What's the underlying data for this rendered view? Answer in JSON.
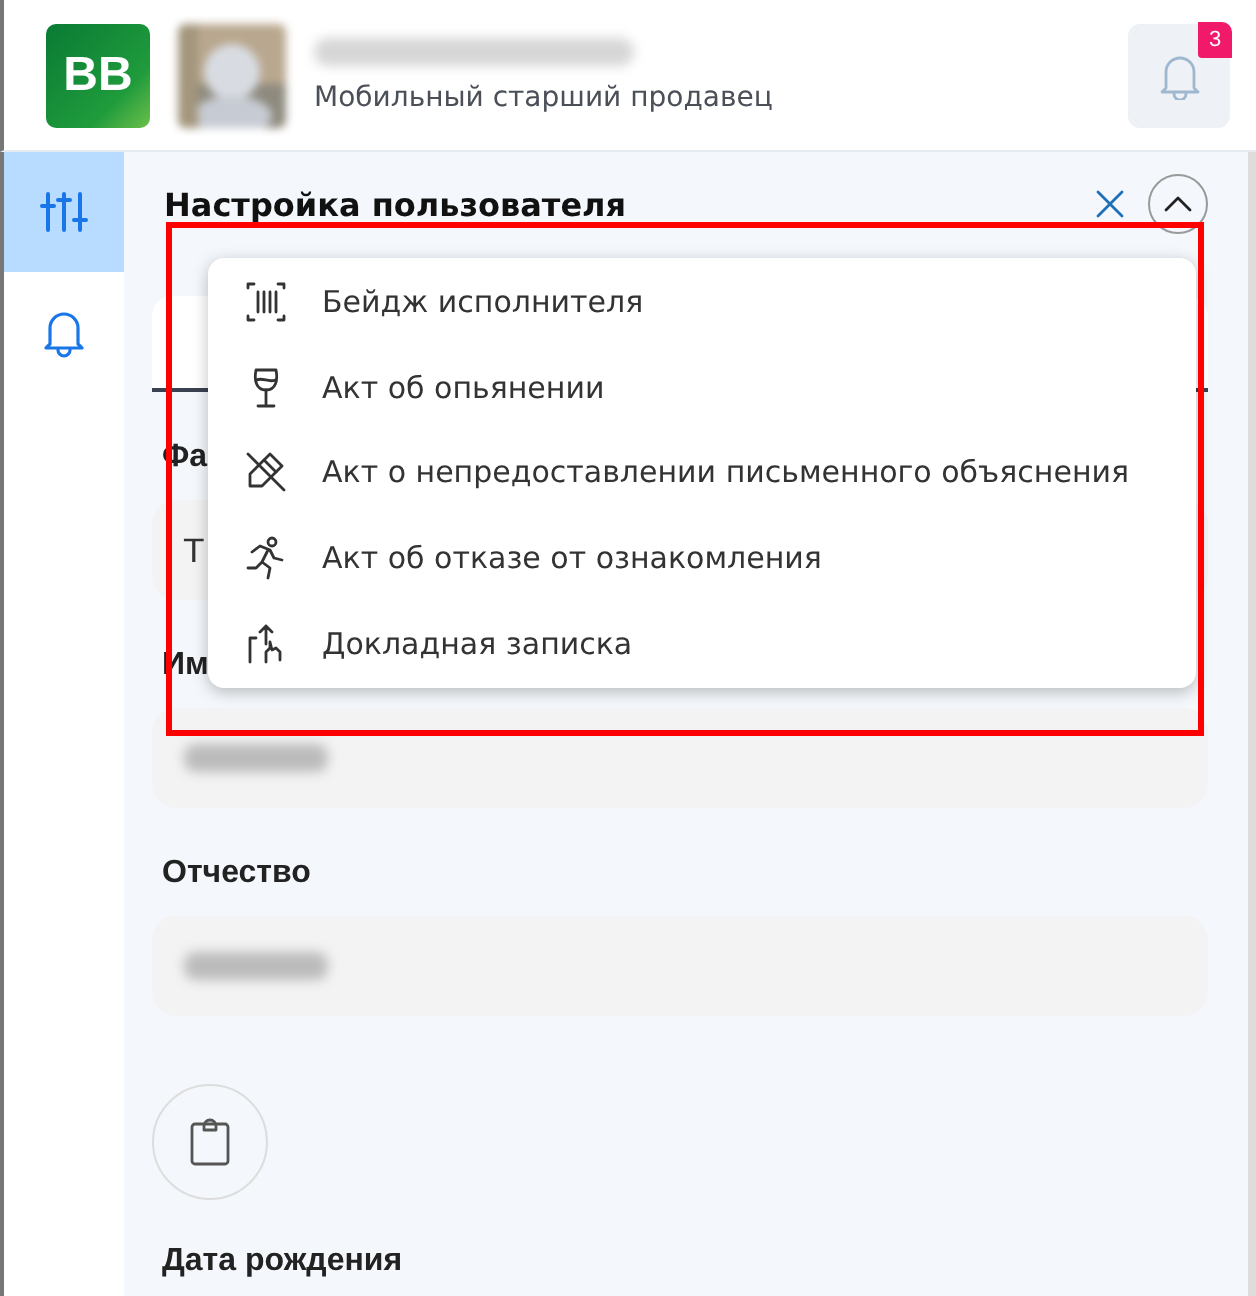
{
  "header": {
    "logo": "BB",
    "user": {
      "role": "Мобильный старший продавец"
    },
    "notifications": {
      "count": "3"
    }
  },
  "sidebar": {
    "items": [
      {
        "kind": "settings",
        "selected": true
      },
      {
        "kind": "notifications",
        "selected": false
      }
    ]
  },
  "panel": {
    "title": "Настройка пользователя",
    "expanded": true
  },
  "menu": {
    "items": [
      {
        "kind": "badge",
        "label": "Бейдж исполнителя"
      },
      {
        "kind": "glass",
        "label": "Акт об опьянении"
      },
      {
        "kind": "pencil",
        "label": "Акт о непредоставлении письменного объяснения"
      },
      {
        "kind": "runner",
        "label": "Акт об отказе от ознакомления"
      },
      {
        "kind": "hand",
        "label": "Докладная записка"
      }
    ]
  },
  "form": {
    "fields": [
      {
        "label": "Фа",
        "value": "Т",
        "blurred": false
      },
      {
        "label": "Им",
        "blurred": true
      },
      {
        "label": "Отчество",
        "blurred": true
      }
    ],
    "next_label": "Дата рождения"
  }
}
